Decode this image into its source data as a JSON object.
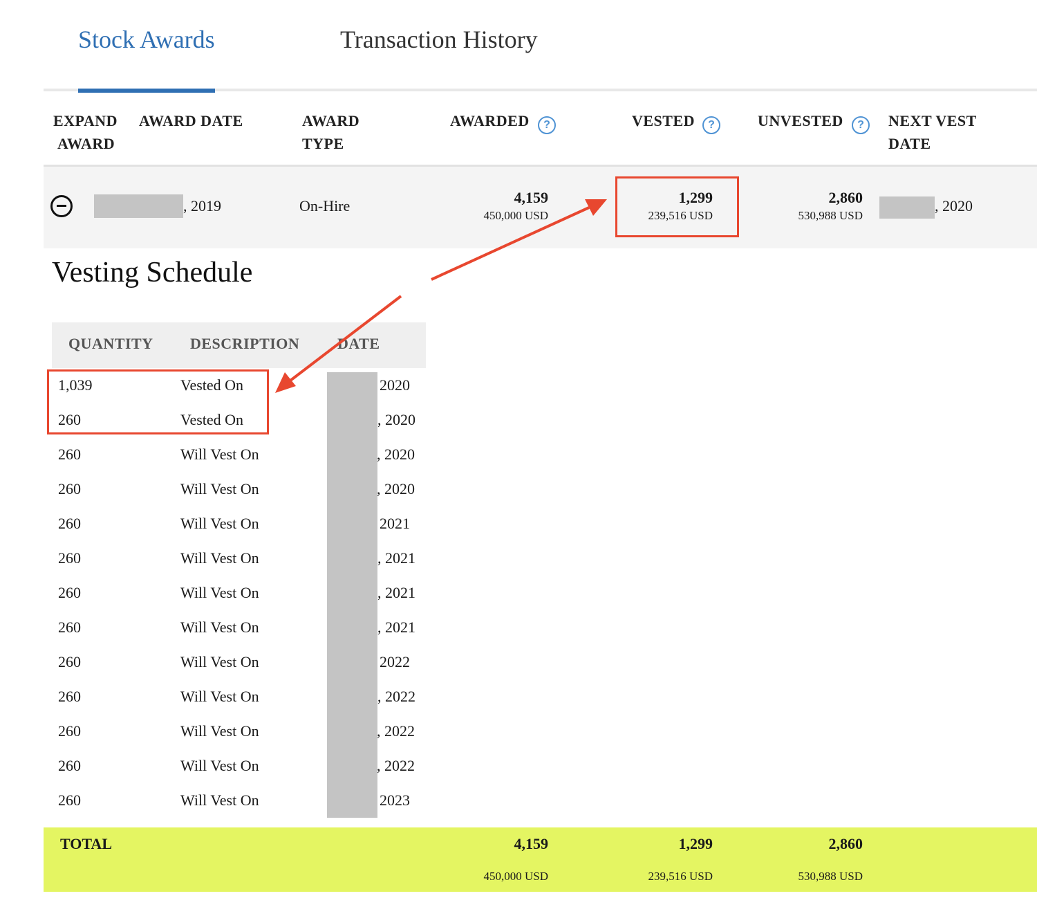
{
  "tabs": [
    {
      "label": "Stock Awards",
      "active": true
    },
    {
      "label": "Transaction History",
      "active": false
    }
  ],
  "columns": {
    "expand_award_1": "EXPAND",
    "expand_award_2": "AWARD",
    "award_date": "AWARD DATE",
    "award_type_1": "AWARD",
    "award_type_2": "TYPE",
    "awarded": "AWARDED",
    "vested": "VESTED",
    "unvested": "UNVESTED",
    "next_vest_1": "NEXT VEST",
    "next_vest_2": "DATE",
    "help_glyph": "?"
  },
  "award": {
    "date_suffix": ", 2019",
    "type": "On-Hire",
    "awarded": {
      "qty": "4,159",
      "usd": "450,000 USD"
    },
    "vested": {
      "qty": "1,299",
      "usd": "239,516 USD"
    },
    "unvested": {
      "qty": "2,860",
      "usd": "530,988 USD"
    },
    "next_vest_suffix": ", 2020"
  },
  "vesting_schedule": {
    "title": "Vesting Schedule",
    "headers": {
      "quantity": "QUANTITY",
      "description": "DESCRIPTION",
      "date": "DATE"
    },
    "rows": [
      {
        "quantity": "1,039",
        "description": "Vested On",
        "date": "2020"
      },
      {
        "quantity": "260",
        "description": "Vested On",
        "date": ", 2020"
      },
      {
        "quantity": "260",
        "description": "Will Vest On",
        "date": ", 2020"
      },
      {
        "quantity": "260",
        "description": "Will Vest On",
        "date": ", 2020"
      },
      {
        "quantity": "260",
        "description": "Will Vest On",
        "date": "2021"
      },
      {
        "quantity": "260",
        "description": "Will Vest On",
        "date": ", 2021"
      },
      {
        "quantity": "260",
        "description": "Will Vest On",
        "date": ", 2021"
      },
      {
        "quantity": "260",
        "description": "Will Vest On",
        "date": ", 2021"
      },
      {
        "quantity": "260",
        "description": "Will Vest On",
        "date": "2022"
      },
      {
        "quantity": "260",
        "description": "Will Vest On",
        "date": ", 2022"
      },
      {
        "quantity": "260",
        "description": "Will Vest On",
        "date": ", 2022"
      },
      {
        "quantity": "260",
        "description": "Will Vest On",
        "date": ", 2022"
      },
      {
        "quantity": "260",
        "description": "Will Vest On",
        "date": "2023"
      }
    ]
  },
  "total": {
    "label": "TOTAL",
    "awarded": {
      "qty": "4,159",
      "usd": "450,000 USD"
    },
    "vested": {
      "qty": "1,299",
      "usd": "239,516 USD"
    },
    "unvested": {
      "qty": "2,860",
      "usd": "530,988 USD"
    }
  },
  "colors": {
    "accent": "#2f6fb3",
    "highlight": "#e8472f",
    "total_bg": "#e4f562",
    "redaction": "#c4c4c4"
  }
}
